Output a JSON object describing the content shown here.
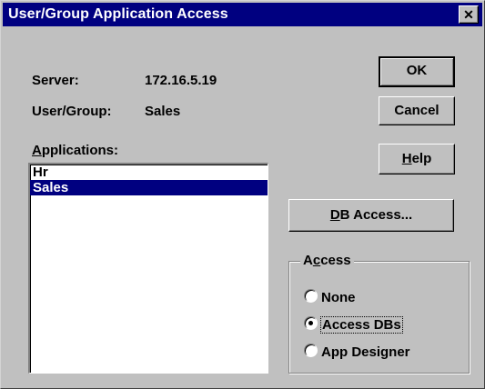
{
  "window": {
    "title": "User/Group Application Access",
    "close_glyph": "✕"
  },
  "info": {
    "server_label": "Server:",
    "server_value": "172.16.5.19",
    "usergroup_label": "User/Group:",
    "usergroup_value": "Sales"
  },
  "applications": {
    "label_prefix": "",
    "label_underlined": "A",
    "label_rest": "pplications:",
    "items": [
      {
        "label": "Hr",
        "selected": false
      },
      {
        "label": "Sales",
        "selected": true
      }
    ]
  },
  "buttons": {
    "ok": "OK",
    "cancel": "Cancel",
    "help_underlined": "H",
    "help_rest": "elp",
    "db_access_underlined": "D",
    "db_access_rest": "B Access..."
  },
  "access_group": {
    "title_prefix": "A",
    "title_underlined": "c",
    "title_rest": "cess",
    "options": [
      {
        "label": "None",
        "checked": false
      },
      {
        "label": "Access DBs",
        "checked": true
      },
      {
        "label": "App Designer",
        "checked": false
      }
    ]
  },
  "colors": {
    "titlebar": "#000080",
    "face": "#c0c0c0",
    "selection": "#000080"
  }
}
